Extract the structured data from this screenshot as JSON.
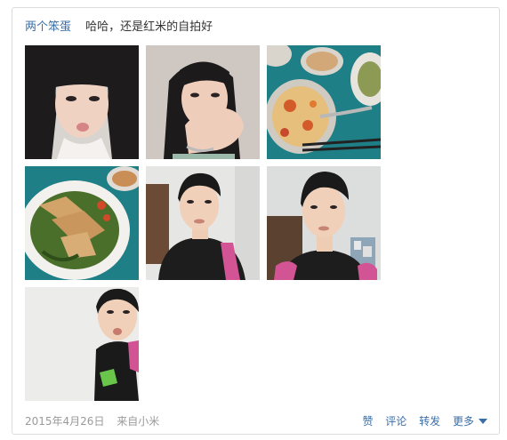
{
  "post": {
    "author": "两个笨蛋",
    "text": "哈哈，还是红米的自拍好"
  },
  "footer": {
    "date": "2015年4月26日",
    "source": "来自小米",
    "actions": {
      "like": "赞",
      "comment": "评论",
      "repost": "转发",
      "more": "更多"
    }
  },
  "colors": {
    "link": "#3a6ea8",
    "meta": "#9a9a9a",
    "border": "#dcdcdc"
  }
}
